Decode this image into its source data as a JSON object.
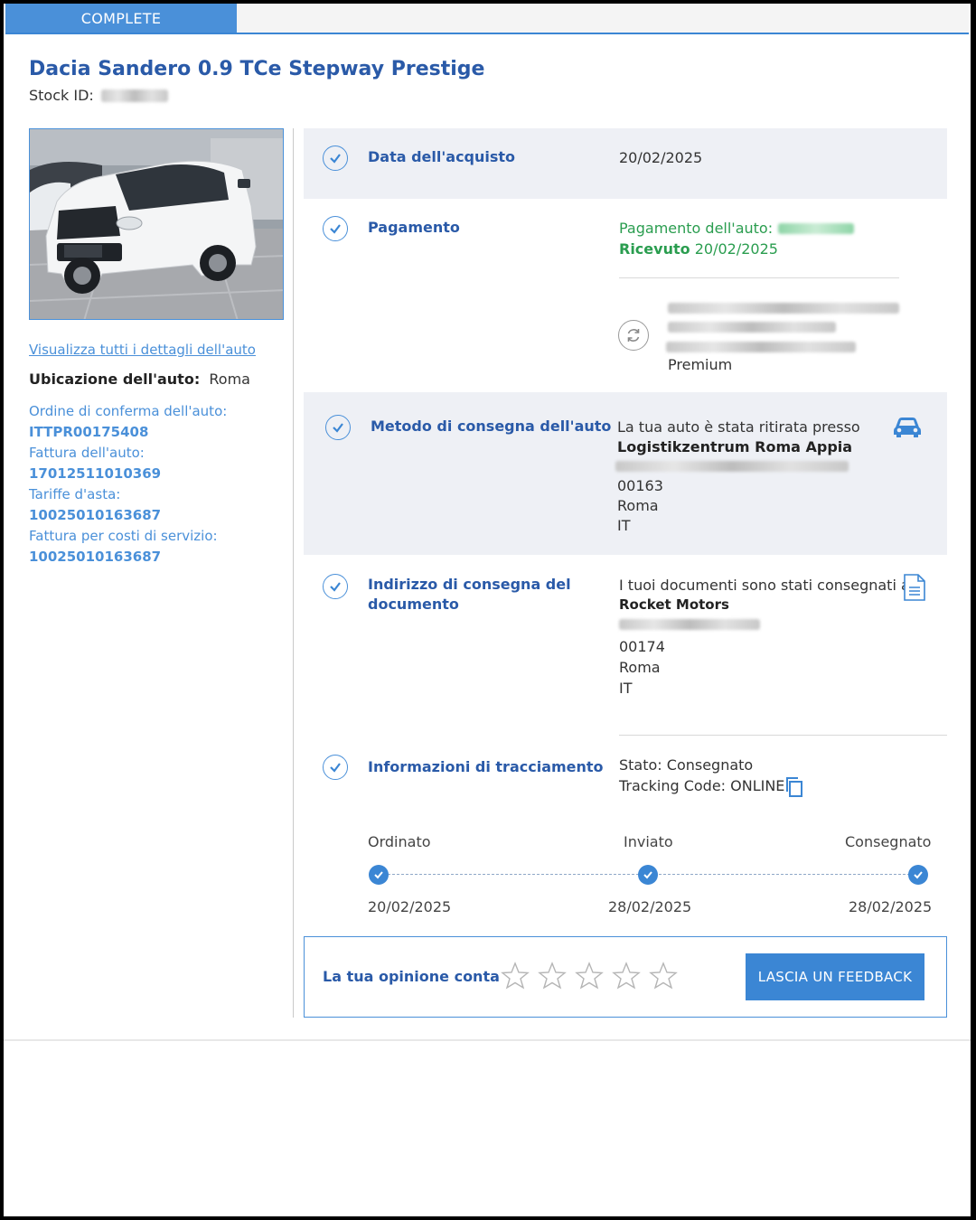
{
  "status": {
    "label": "COMPLETE"
  },
  "vehicle": {
    "title": "Dacia Sandero 0.9 TCe Stepway Prestige",
    "stock_label": "Stock ID:",
    "details_link": "Visualizza tutti i dettagli dell'auto",
    "location_label": "Ubicazione dell'auto:",
    "location_value": "Roma"
  },
  "ids": [
    {
      "label": "Ordine di conferma dell'auto:",
      "value": "ITTPR00175408"
    },
    {
      "label": "Fattura dell'auto:",
      "value": "17012511010369"
    },
    {
      "label": "Tariffe d'asta:",
      "value": "10025010163687"
    },
    {
      "label": "Fattura per costi di servizio:",
      "value": "10025010163687"
    }
  ],
  "purchase": {
    "label": "Data dell'acquisto",
    "date": "20/02/2025"
  },
  "payment": {
    "label": "Pagamento",
    "line1": "Pagamento dell'auto:",
    "received_label": "Ricevuto",
    "received_date": "20/02/2025",
    "plan": "Premium"
  },
  "delivery": {
    "label": "Metodo di consegna dell'auto",
    "intro": "La tua auto è stata ritirata presso",
    "name": "Logistikzentrum Roma Appia",
    "zip": "00163",
    "city": "Roma",
    "country": "IT"
  },
  "documents": {
    "label_line1": "Indirizzo di consegna del",
    "label_line2": "documento",
    "intro": "I tuoi documenti sono stati consegnati a",
    "name": "Rocket Motors",
    "zip": "00174",
    "city": "Roma",
    "country": "IT"
  },
  "tracking": {
    "label": "Informazioni di tracciamento",
    "status": "Stato: Consegnato",
    "code": "Tracking Code: ONLINE",
    "steps": [
      {
        "name": "Ordinato",
        "date": "20/02/2025"
      },
      {
        "name": "Inviato",
        "date": "28/02/2025"
      },
      {
        "name": "Consegnato",
        "date": "28/02/2025"
      }
    ]
  },
  "feedback": {
    "label": "La tua opinione conta",
    "button": "LASCIA UN FEEDBACK",
    "rating": 0,
    "max_rating": 5
  },
  "colors": {
    "accent": "#3b86d4",
    "title": "#2a5aa8",
    "success": "#2a9d4f",
    "section_bg": "#eef0f5"
  }
}
